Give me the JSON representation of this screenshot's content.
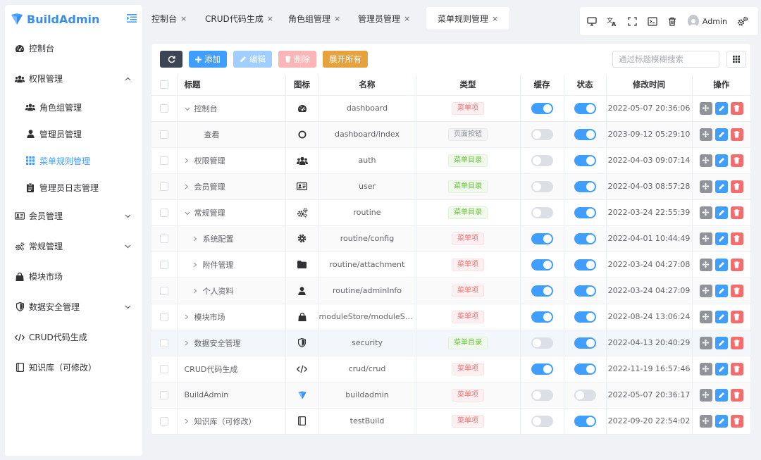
{
  "app": {
    "brand": "BuildAdmin"
  },
  "sidebar": {
    "items": [
      {
        "label": "控制台",
        "icon": "dashboard-icon"
      },
      {
        "label": "权限管理",
        "icon": "users-icon",
        "expanded": true
      },
      {
        "label": "角色组管理",
        "icon": "users-icon",
        "sub": true
      },
      {
        "label": "管理员管理",
        "icon": "user-icon",
        "sub": true
      },
      {
        "label": "菜单规则管理",
        "icon": "grid-icon",
        "sub": true,
        "active": true
      },
      {
        "label": "管理员日志管理",
        "icon": "clipboard-icon",
        "sub": true
      },
      {
        "label": "会员管理",
        "icon": "id-card-icon"
      },
      {
        "label": "常规管理",
        "icon": "cogs-icon"
      },
      {
        "label": "模块市场",
        "icon": "shopping-bag-icon"
      },
      {
        "label": "数据安全管理",
        "icon": "shield-icon"
      },
      {
        "label": "CRUD代码生成",
        "icon": "code-icon"
      },
      {
        "label": "知识库（可修改）",
        "icon": "book-icon"
      }
    ]
  },
  "tabs": [
    {
      "label": "控制台"
    },
    {
      "label": "CRUD代码生成"
    },
    {
      "label": "角色组管理"
    },
    {
      "label": "管理员管理"
    },
    {
      "label": "菜单规则管理",
      "active": true
    }
  ],
  "header": {
    "user": "Admin"
  },
  "toolbar": {
    "add_label": "添加",
    "edit_label": "编辑",
    "delete_label": "删除",
    "expand_label": "展开所有",
    "search_placeholder": "通过标题模糊搜索"
  },
  "table": {
    "columns": [
      "标题",
      "图标",
      "名称",
      "类型",
      "缓存",
      "状态",
      "修改时间",
      "操作"
    ],
    "rows": [
      {
        "title": "控制台",
        "level": 0,
        "chevron": "down",
        "icon": "dashboard-icon",
        "name": "dashboard",
        "type": "菜单项",
        "type_kind": "menu",
        "cache": true,
        "status": true,
        "time": "2022-05-07 20:36:06"
      },
      {
        "title": "查看",
        "level": 1,
        "chevron": "none",
        "icon": "circle-icon",
        "name": "dashboard/index",
        "type": "页面按钮",
        "type_kind": "button",
        "cache": false,
        "status": true,
        "time": "2023-09-12 05:29:10"
      },
      {
        "title": "权限管理",
        "level": 0,
        "chevron": "right",
        "icon": "users-icon",
        "name": "auth",
        "type": "菜单目录",
        "type_kind": "dir",
        "cache": false,
        "status": true,
        "time": "2022-04-03 09:07:14"
      },
      {
        "title": "会员管理",
        "level": 0,
        "chevron": "right",
        "icon": "id-card-icon",
        "name": "user",
        "type": "菜单目录",
        "type_kind": "dir",
        "cache": false,
        "status": true,
        "time": "2022-04-03 08:57:28"
      },
      {
        "title": "常规管理",
        "level": 0,
        "chevron": "down",
        "icon": "cogs-icon",
        "name": "routine",
        "type": "菜单目录",
        "type_kind": "dir",
        "cache": false,
        "status": true,
        "time": "2022-03-24 22:55:39"
      },
      {
        "title": "系统配置",
        "level": 1,
        "chevron": "right",
        "icon": "gear-icon",
        "name": "routine/config",
        "type": "菜单项",
        "type_kind": "menu",
        "cache": true,
        "status": true,
        "time": "2022-04-01 10:44:49"
      },
      {
        "title": "附件管理",
        "level": 1,
        "chevron": "right",
        "icon": "folder-icon",
        "name": "routine/attachment",
        "type": "菜单项",
        "type_kind": "menu",
        "cache": true,
        "status": true,
        "time": "2022-03-24 04:27:08"
      },
      {
        "title": "个人资料",
        "level": 1,
        "chevron": "right",
        "icon": "user-icon",
        "name": "routine/adminInfo",
        "type": "菜单项",
        "type_kind": "menu",
        "cache": true,
        "status": true,
        "time": "2022-03-24 04:27:09"
      },
      {
        "title": "模块市场",
        "level": 0,
        "chevron": "right",
        "icon": "shopping-bag-icon",
        "name": "moduleStore/moduleSt…",
        "type": "菜单项",
        "type_kind": "menu",
        "cache": true,
        "status": true,
        "time": "2022-08-24 13:06:24"
      },
      {
        "title": "数据安全管理",
        "level": 0,
        "chevron": "right",
        "icon": "shield-icon",
        "name": "security",
        "type": "菜单目录",
        "type_kind": "dir",
        "cache": false,
        "status": true,
        "time": "2022-04-13 20:40:29"
      },
      {
        "title": "CRUD代码生成",
        "level": 0,
        "chevron": "none",
        "icon": "code-icon",
        "name": "crud/crud",
        "type": "菜单项",
        "type_kind": "menu",
        "cache": true,
        "status": true,
        "time": "2022-11-19 16:57:46"
      },
      {
        "title": "BuildAdmin",
        "level": 0,
        "chevron": "none",
        "icon": "buildadmin-logo-icon",
        "name": "buildadmin",
        "type": "菜单项",
        "type_kind": "menu",
        "cache": false,
        "status": false,
        "time": "2022-05-07 20:36:17"
      },
      {
        "title": "知识库（可修改）",
        "level": 0,
        "chevron": "right",
        "icon": "book-icon",
        "name": "testBuild",
        "type": "菜单项",
        "type_kind": "menu",
        "cache": false,
        "status": true,
        "time": "2022-09-20 22:54:02"
      }
    ]
  }
}
